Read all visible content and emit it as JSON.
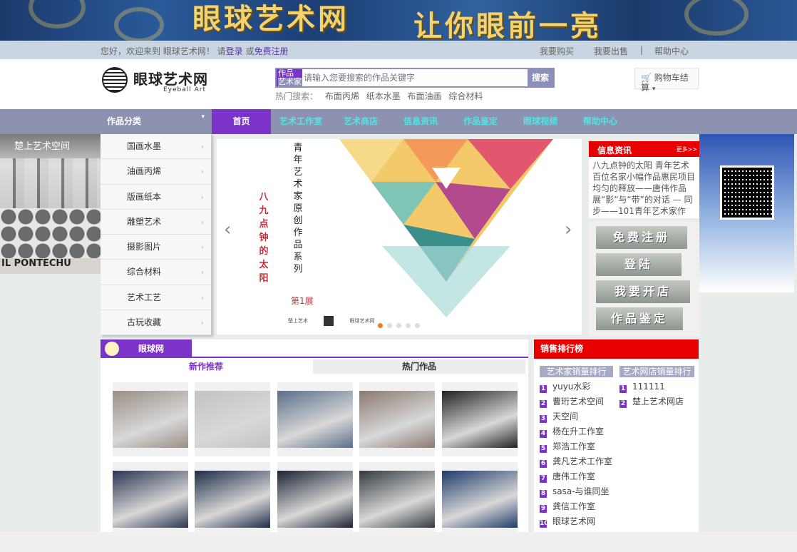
{
  "banner": {
    "slogan1": "眼球艺术网",
    "slogan2": "让你眼前一亮"
  },
  "topbar": {
    "welcome": "您好，欢迎来到 眼球艺术网！ 请",
    "login": "登录",
    "or": " 或",
    "register": "免费注册",
    "buy": "我要购买",
    "sell": "我要出售",
    "separator": "|",
    "help": "帮助中心"
  },
  "header": {
    "logo_cn": "眼球艺术网",
    "logo_en": "Eyeball Art",
    "search": {
      "cat1": "作品",
      "cat2": "艺术家",
      "placeholder": "请输入您要搜索的作品关键字",
      "button": "搜索"
    },
    "hot": {
      "label": "热门搜索：",
      "keywords": [
        "布面丙烯",
        "纸本水墨",
        "布面油画",
        "综合材料"
      ]
    },
    "cart": "购物车结算",
    "cart_arrow": "▾"
  },
  "nav": {
    "category": "作品分类",
    "category_arrow": "▾",
    "items": [
      "首页",
      "艺术工作室",
      "艺术商店",
      "信息资讯",
      "作品鉴定",
      "眼球视频",
      "帮助中心"
    ]
  },
  "left_ads": {
    "ad1": "楚上艺术空间",
    "ad2": "IL PONTECHU"
  },
  "categories": [
    "国画水墨",
    "油画丙烯",
    "版画纸本",
    "雕塑艺术",
    "摄影图片",
    "综合材料",
    "艺术工艺",
    "古玩收藏"
  ],
  "carousel": {
    "title_vertical": "青年艺术家原创作品系列",
    "subtitle_vertical": "八九点钟的太阳",
    "edition": "第1展",
    "logos": [
      "楚上艺术",
      "眼球艺术网"
    ],
    "prev": "‹",
    "next": "›",
    "slides": 5,
    "active": 0
  },
  "news": {
    "title": "信息资讯",
    "more": "更多>>",
    "text": "八九点钟的太阳 青年艺术百位名家小幅作品惠民项目均匀的释放——唐伟作品展“影”与“带”的对话 — 同步——101青年艺术家作"
  },
  "side_buttons": [
    "免费注册",
    "登陆",
    "我要开店",
    "作品鉴定"
  ],
  "products": {
    "brand": "眼球网",
    "tabs": [
      "新作推荐",
      "热门作品"
    ],
    "thumb_colors": [
      [
        "#9a8f86",
        "#c2c3c2",
        "#5b6f8a",
        "#8a7a70",
        "#222222"
      ],
      [
        "#2a3550",
        "#1e2c48",
        "#1c2433",
        "#333a3f",
        "#1f3b6a"
      ]
    ]
  },
  "ranking": {
    "title": "销售排行榜",
    "col1_title": "艺术家销量排行",
    "col2_title": "艺术网店销量排行",
    "col1": [
      "yuyu水彩",
      "曹珩艺术空间",
      "天空间",
      "杨在升工作室",
      "郑浩工作室",
      "龚凡艺术工作室",
      "唐伟工作室",
      "sasa-与谁同坐",
      "龚信工作室",
      "眼球艺术网"
    ],
    "col2": [
      "111111",
      "楚上艺术网店"
    ]
  }
}
